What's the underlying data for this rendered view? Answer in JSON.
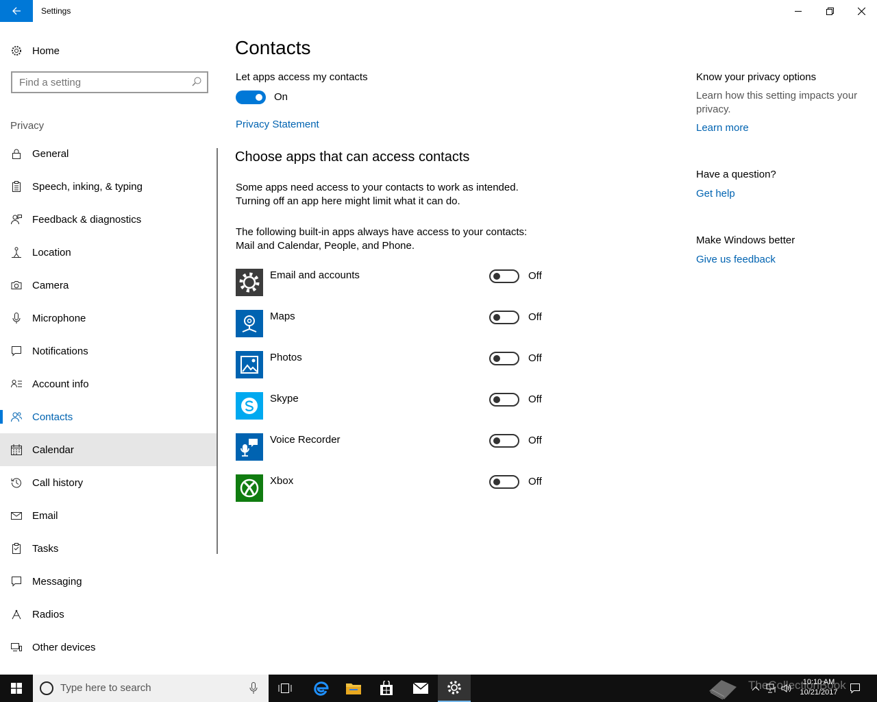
{
  "window": {
    "title": "Settings"
  },
  "sidebar": {
    "home_label": "Home",
    "search_placeholder": "Find a setting",
    "section_label": "Privacy",
    "items": [
      {
        "label": "General",
        "icon": "lock-icon"
      },
      {
        "label": "Speech, inking, & typing",
        "icon": "clipboard-icon"
      },
      {
        "label": "Feedback & diagnostics",
        "icon": "feedback-person-icon"
      },
      {
        "label": "Location",
        "icon": "location-person-icon"
      },
      {
        "label": "Camera",
        "icon": "camera-icon"
      },
      {
        "label": "Microphone",
        "icon": "microphone-icon"
      },
      {
        "label": "Notifications",
        "icon": "notification-icon"
      },
      {
        "label": "Account info",
        "icon": "account-card-icon"
      },
      {
        "label": "Contacts",
        "icon": "contacts-icon"
      },
      {
        "label": "Calendar",
        "icon": "calendar-icon"
      },
      {
        "label": "Call history",
        "icon": "history-icon"
      },
      {
        "label": "Email",
        "icon": "mail-icon"
      },
      {
        "label": "Tasks",
        "icon": "tasks-icon"
      },
      {
        "label": "Messaging",
        "icon": "message-icon"
      },
      {
        "label": "Radios",
        "icon": "radio-icon"
      },
      {
        "label": "Other devices",
        "icon": "devices-icon"
      }
    ]
  },
  "main": {
    "title": "Contacts",
    "master_toggle_label": "Let apps access my contacts",
    "master_toggle_state": "On",
    "privacy_link": "Privacy Statement",
    "section_heading": "Choose apps that can access contacts",
    "para1_line1": "Some apps need access to your contacts to work as intended.",
    "para1_line2": "Turning off an app here might limit what it can do.",
    "para2_line1": "The following built-in apps always have access to your contacts:",
    "para2_line2": "Mail and Calendar, People, and Phone.",
    "apps": [
      {
        "name": "Email and accounts",
        "state": "Off",
        "color": "#3c3c3c",
        "icon": "gear-icon"
      },
      {
        "name": "Maps",
        "state": "Off",
        "color": "#0063b1",
        "icon": "maps-icon"
      },
      {
        "name": "Photos",
        "state": "Off",
        "color": "#0063b1",
        "icon": "photos-icon"
      },
      {
        "name": "Skype",
        "state": "Off",
        "color": "#00a9f0",
        "icon": "skype-icon"
      },
      {
        "name": "Voice Recorder",
        "state": "Off",
        "color": "#0063b1",
        "icon": "voice-recorder-icon"
      },
      {
        "name": "Xbox",
        "state": "Off",
        "color": "#107c10",
        "icon": "xbox-icon"
      }
    ]
  },
  "right": {
    "h1": "Know your privacy options",
    "p1": "Learn how this setting impacts your privacy.",
    "link1": "Learn more",
    "h2": "Have a question?",
    "link2": "Get help",
    "h3": "Make Windows better",
    "link3": "Give us feedback"
  },
  "taskbar": {
    "search_placeholder": "Type here to search",
    "time": "10:10 AM",
    "date": "10/21/2017",
    "watermark": "TheCollectionBook"
  },
  "colors": {
    "accent": "#0078d7",
    "link": "#0063b1",
    "taskbar": "#101010"
  }
}
